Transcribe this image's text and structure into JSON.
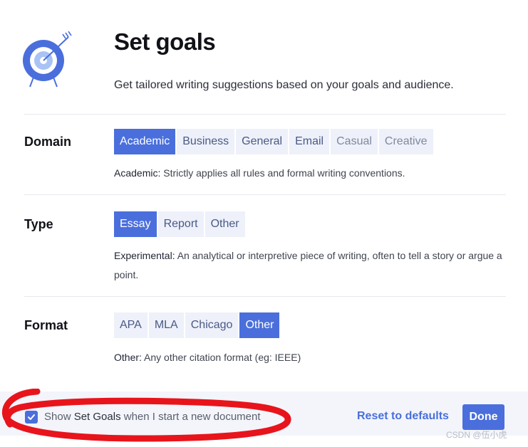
{
  "header": {
    "title": "Set goals",
    "subtitle": "Get tailored writing suggestions based on your goals and audience.",
    "logo_icon": "target-arrow-icon"
  },
  "rows": {
    "domain": {
      "label": "Domain",
      "options": [
        "Academic",
        "Business",
        "General",
        "Email",
        "Casual",
        "Creative"
      ],
      "selected": "Academic",
      "desc_key": "Academic:",
      "desc_text": " Strictly applies all rules and formal writing conventions."
    },
    "type": {
      "label": "Type",
      "options": [
        "Essay",
        "Report",
        "Other"
      ],
      "selected": "Essay",
      "desc_key": "Experimental:",
      "desc_text": " An analytical or interpretive piece of writing, often to tell a story or argue a point."
    },
    "format": {
      "label": "Format",
      "options": [
        "APA",
        "MLA",
        "Chicago",
        "Other"
      ],
      "selected": "Other",
      "desc_key": "Other:",
      "desc_text": " Any other citation format (eg: IEEE)"
    }
  },
  "footer": {
    "checkbox_checked": true,
    "checkbox_prefix": "Show ",
    "checkbox_strong": "Set Goals",
    "checkbox_suffix": " when I start a new document",
    "reset_label": "Reset to defaults",
    "done_label": "Done"
  },
  "watermark": "CSDN @伍小虎",
  "colors": {
    "accent": "#4a6fdc",
    "option_bg": "#eef1fa",
    "annotation": "#e8141c"
  }
}
